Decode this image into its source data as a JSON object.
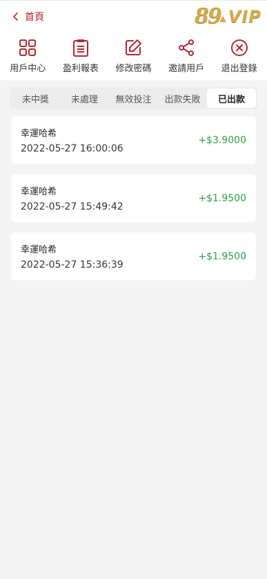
{
  "header": {
    "back_label": "首頁",
    "logo_text_num": "89",
    "logo_text_vip": "VIP"
  },
  "nav": {
    "items": [
      {
        "label": "用戶中心",
        "icon": "grid-icon"
      },
      {
        "label": "盈利報表",
        "icon": "clipboard-icon"
      },
      {
        "label": "修改密碼",
        "icon": "edit-icon"
      },
      {
        "label": "邀請用戶",
        "icon": "share-icon"
      },
      {
        "label": "退出登錄",
        "icon": "close-circle-icon"
      }
    ]
  },
  "tabs": [
    {
      "label": "未中獎",
      "active": false
    },
    {
      "label": "未處理",
      "active": false
    },
    {
      "label": "無效投注",
      "active": false
    },
    {
      "label": "出款失敗",
      "active": false
    },
    {
      "label": "已出款",
      "active": true
    }
  ],
  "records": [
    {
      "name": "幸運哈希",
      "time": "2022-05-27 16:00:06",
      "amount": "+$3.9000"
    },
    {
      "name": "幸運哈希",
      "time": "2022-05-27 15:49:42",
      "amount": "+$1.9500"
    },
    {
      "name": "幸運哈希",
      "time": "2022-05-27 15:36:39",
      "amount": "+$1.9500"
    }
  ],
  "colors": {
    "brand_red": "#b8232f",
    "amount_green": "#2e9b4a",
    "logo_gold": "#d6a94a"
  }
}
